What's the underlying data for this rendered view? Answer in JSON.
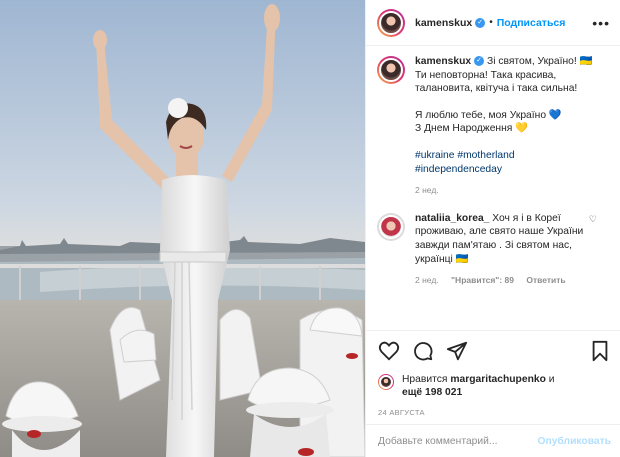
{
  "header": {
    "username": "kamenskux",
    "follow_label": "Подписаться",
    "separator": "•"
  },
  "caption": {
    "username": "kamenskux",
    "line1": "Зі святом, Україно! 🇺🇦",
    "line2": "Ти неповторна! Така красива,",
    "line3": "талановита, квітуча і така сильна!",
    "line4": "Я люблю тебе, моя Україно 💙",
    "line5": "З Днем Народження 💛",
    "hashtags": [
      "#ukraine",
      "#motherland",
      "#independenceday"
    ],
    "time": "2 нед."
  },
  "comment": {
    "username": "nataliia_korea_",
    "text": "Хоч я і в Кореї проживаю, але свято наше України завжди пам'ятаю . Зі святом нас, українці 🇺🇦",
    "time": "2 нед.",
    "likes": "\"Нравится\": 89",
    "reply": "Ответить"
  },
  "likes": {
    "text_prefix": "Нравится",
    "liker": "margaritachupenko",
    "suffix": "и",
    "others": "ещё 198 021"
  },
  "date": "24 АВГУСТА",
  "add_comment": {
    "placeholder": "Добавьте комментарий...",
    "publish": "Опубликовать"
  },
  "colors": {
    "accent": "#0095f6",
    "verified": "#3897f0",
    "muted": "#8e8e8e",
    "hashtag": "#00376b"
  },
  "icons": [
    "more-icon",
    "verified-icon",
    "heart-icon",
    "comment-icon",
    "share-icon",
    "bookmark-icon"
  ]
}
